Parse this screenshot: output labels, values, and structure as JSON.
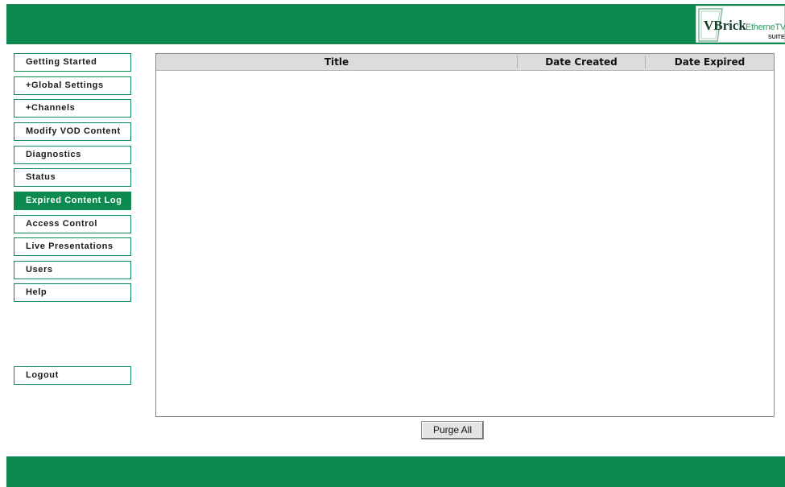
{
  "header": {
    "logo_brand": "VBrick",
    "logo_product": "EtherneTV",
    "logo_suite": "SUITE",
    "logo_icon": "vbrick-logo-icon"
  },
  "sidebar": {
    "items": [
      {
        "label": "Getting Started"
      },
      {
        "label": "+Global Settings"
      },
      {
        "label": "+Channels"
      },
      {
        "label": "Modify VOD Content"
      },
      {
        "label": "Diagnostics"
      },
      {
        "label": "Status"
      },
      {
        "label": "Expired Content Log",
        "active": true
      },
      {
        "label": "Access Control"
      },
      {
        "label": "Live Presentations"
      },
      {
        "label": "Users"
      },
      {
        "label": "Help"
      }
    ],
    "logout_label": "Logout"
  },
  "table": {
    "columns": [
      "Title",
      "Date Created",
      "Date Expired"
    ],
    "rows": []
  },
  "actions": {
    "purge_label": "Purge All"
  },
  "colors": {
    "brand_green": "#0c8a4f",
    "header_gray": "#dcdcdc"
  }
}
